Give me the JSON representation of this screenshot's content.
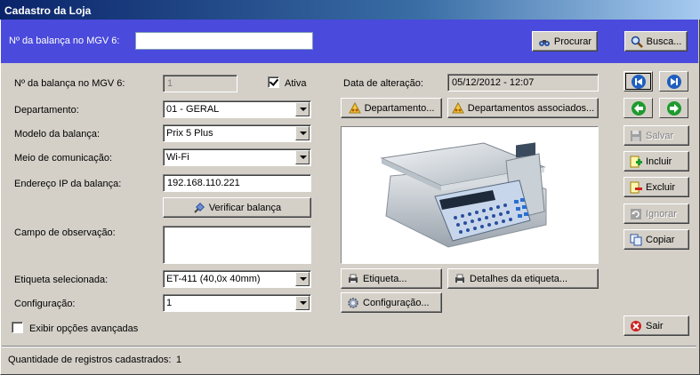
{
  "window": {
    "title": "Cadastro da Loja"
  },
  "search": {
    "label": "Nº da balança no MGV 6:",
    "value": "",
    "search_button": "Procurar",
    "busca_button": "Busca..."
  },
  "form": {
    "balanca_label": "Nº da balança no MGV 6:",
    "balanca_value": "1",
    "ativa_label": "Ativa",
    "ativa_checked": true,
    "departamento_label": "Departamento:",
    "departamento_value": "01 - GERAL",
    "modelo_label": "Modelo da balança:",
    "modelo_value": "Prix 5 Plus",
    "meio_label": "Meio de comunicação:",
    "meio_value": "Wi-Fi",
    "ip_label": "Endereço IP da balança:",
    "ip_value": "192.168.110.221",
    "verificar_button": "Verificar balança",
    "observacao_label": "Campo de observação:",
    "observacao_value": "",
    "etiqueta_label": "Etiqueta selecionada:",
    "etiqueta_value": "ET-411 (40,0x  40mm)",
    "configuracao_label": "Configuração:",
    "configuracao_value": "1",
    "avancadas_label": "Exibir opções avançadas",
    "avancadas_checked": false
  },
  "center": {
    "data_label": "Data de alteração:",
    "data_value": "05/12/2012 - 12:07",
    "departamento_button": "Departamento...",
    "departamentos_assoc_button": "Departamentos associados...",
    "etiqueta_button": "Etiqueta...",
    "detalhes_button": "Detalhes da etiqueta...",
    "configuracao_button": "Configuração..."
  },
  "actions": {
    "salvar": "Salvar",
    "incluir": "Incluir",
    "excluir": "Excluir",
    "ignorar": "Ignorar",
    "copiar": "Copiar",
    "sair": "Sair"
  },
  "status": {
    "label": "Quantidade de registros cadastrados:",
    "count": "1"
  },
  "colors": {
    "search_bar": "#4a4adc",
    "title_bar": "#0a246a",
    "nav_blue": "#1f5fbf",
    "nav_green": "#1f9a2f"
  }
}
